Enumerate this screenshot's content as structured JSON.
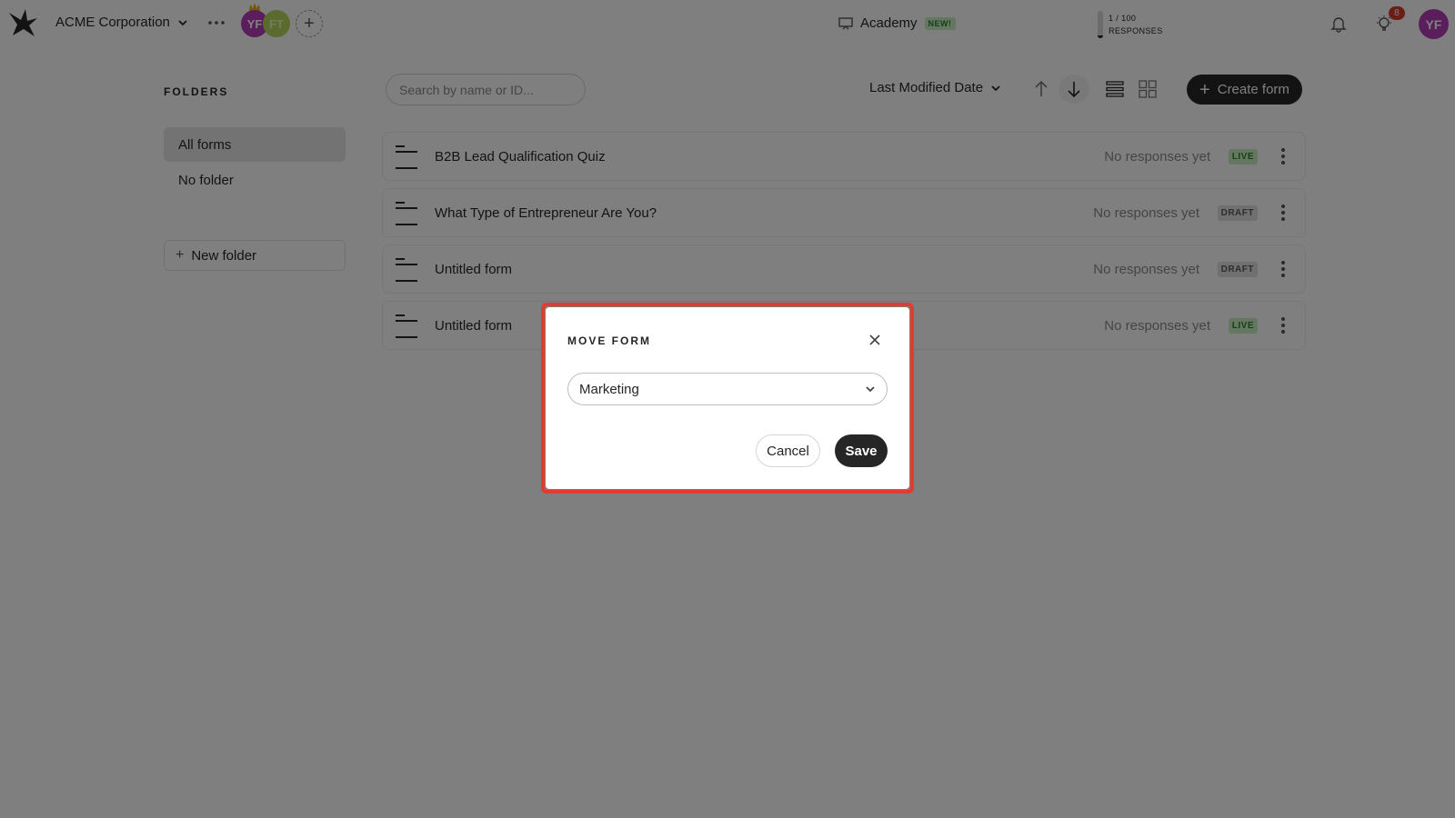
{
  "header": {
    "org_name": "ACME Corporation",
    "avatars": [
      "YF",
      "FT"
    ],
    "academy_label": "Academy",
    "academy_badge": "NEW!",
    "responses_count": "1 / 100",
    "responses_label": "RESPONSES",
    "responses_used_fraction": 0.01,
    "notification_count": "8",
    "user_avatar": "YF"
  },
  "sidebar": {
    "title": "FOLDERS",
    "items": [
      {
        "label": "All forms",
        "active": true
      },
      {
        "label": "No folder",
        "active": false
      }
    ],
    "new_folder_label": "New folder"
  },
  "toolbar": {
    "search_placeholder": "Search by name or ID...",
    "sort_label": "Last Modified Date",
    "create_label": "Create form"
  },
  "forms": [
    {
      "name": "B2B Lead Qualification Quiz",
      "responses": "No responses yet",
      "status": "LIVE"
    },
    {
      "name": "What Type of Entrepreneur Are You?",
      "responses": "No responses yet",
      "status": "DRAFT"
    },
    {
      "name": "Untitled form",
      "responses": "No responses yet",
      "status": "DRAFT"
    },
    {
      "name": "Untitled form",
      "responses": "No responses yet",
      "status": "LIVE"
    }
  ],
  "modal": {
    "title": "MOVE FORM",
    "selected_folder": "Marketing",
    "cancel_label": "Cancel",
    "save_label": "Save"
  },
  "colors": {
    "accent": "#262627",
    "avatar_purple": "#b23cb6",
    "live_bg": "#c9f0c2",
    "highlight": "#e23b30"
  }
}
